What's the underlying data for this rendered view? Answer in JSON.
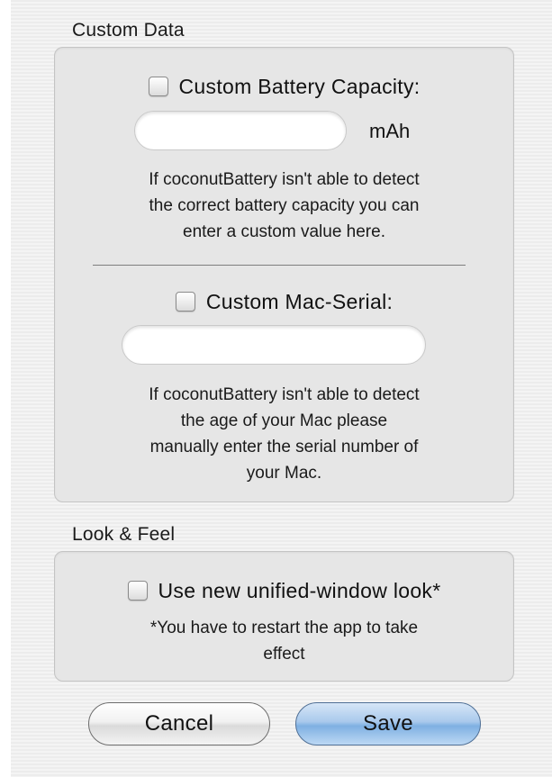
{
  "custom_data": {
    "title": "Custom Data",
    "battery": {
      "checkbox_label": "Custom Battery Capacity:",
      "checked": false,
      "input_value": "",
      "unit": "mAh",
      "help": "If coconutBattery isn't able to detect\nthe correct battery capacity you can\nenter a custom value here."
    },
    "serial": {
      "checkbox_label": "Custom Mac-Serial:",
      "checked": false,
      "input_value": "",
      "help": "If coconutBattery isn't able to detect\nthe age of your Mac please\nmanually enter the serial number of\nyour Mac."
    }
  },
  "look_and_feel": {
    "title": "Look & Feel",
    "unified": {
      "checkbox_label": "Use new unified-window look*",
      "checked": false,
      "note": "*You have to restart the app to take\neffect"
    }
  },
  "buttons": {
    "cancel_label": "Cancel",
    "save_label": "Save"
  }
}
